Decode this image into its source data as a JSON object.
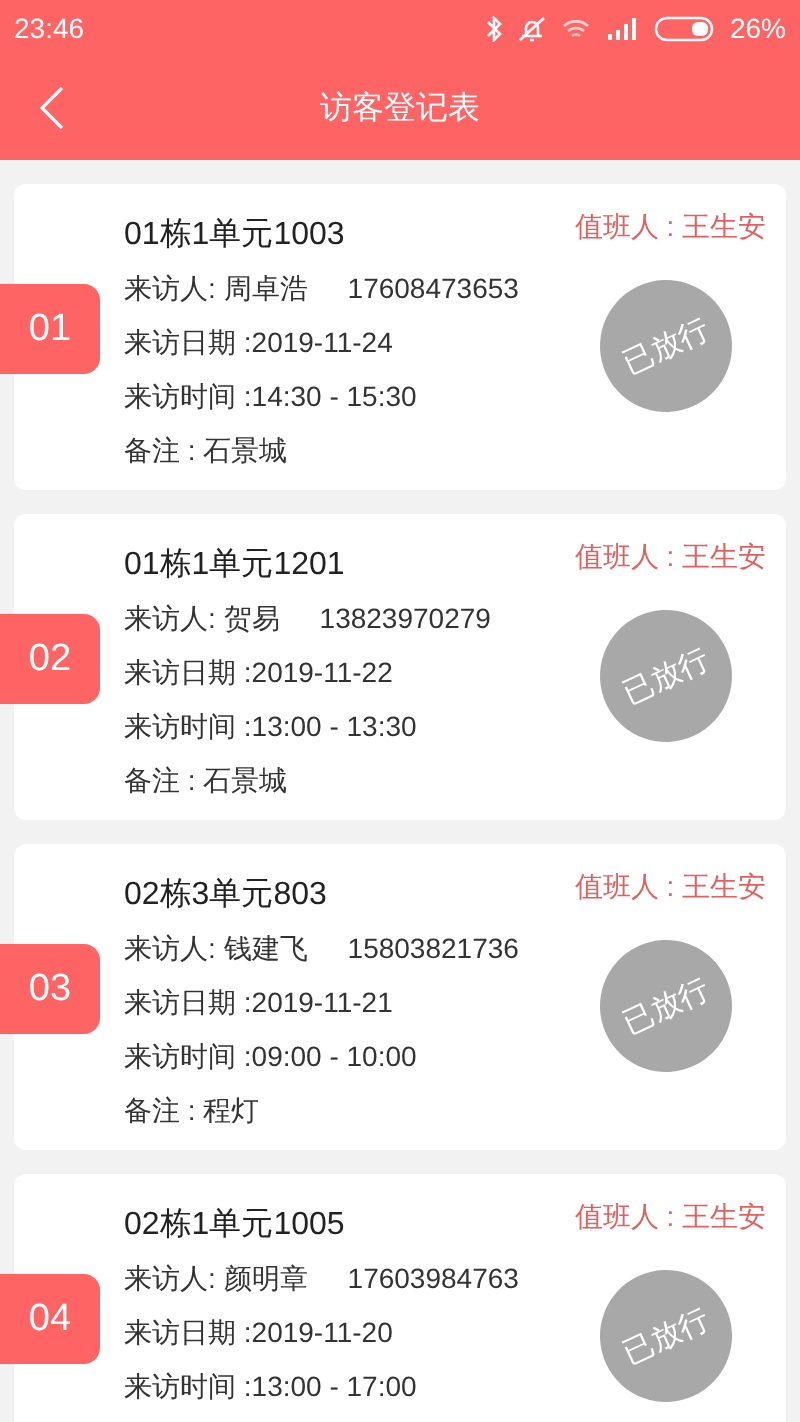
{
  "status_bar": {
    "time": "23:46",
    "battery": "26%"
  },
  "header": {
    "title": "访客登记表"
  },
  "visits": [
    {
      "index": "01",
      "unit": "01栋1单元1003",
      "duty": "值班人 : 王生安",
      "visitor": "来访人: 周卓浩",
      "phone": "17608473653",
      "date": "来访日期 :2019-11-24",
      "time": "来访时间 :14:30 - 15:30",
      "note": "备注 : 石景城",
      "stamp": "已放行"
    },
    {
      "index": "02",
      "unit": "01栋1单元1201",
      "duty": "值班人 : 王生安",
      "visitor": "来访人: 贺易",
      "phone": "13823970279",
      "date": "来访日期 :2019-11-22",
      "time": "来访时间 :13:00 - 13:30",
      "note": "备注 : 石景城",
      "stamp": "已放行"
    },
    {
      "index": "03",
      "unit": "02栋3单元803",
      "duty": "值班人 : 王生安",
      "visitor": "来访人: 钱建飞",
      "phone": "15803821736",
      "date": "来访日期 :2019-11-21",
      "time": "来访时间 :09:00 - 10:00",
      "note": "备注 : 程灯",
      "stamp": "已放行"
    },
    {
      "index": "04",
      "unit": "02栋1单元1005",
      "duty": "值班人 : 王生安",
      "visitor": "来访人: 颜明章",
      "phone": "17603984763",
      "date": "来访日期 :2019-11-20",
      "time": "来访时间 :13:00 - 17:00",
      "stamp": "已放行"
    }
  ]
}
